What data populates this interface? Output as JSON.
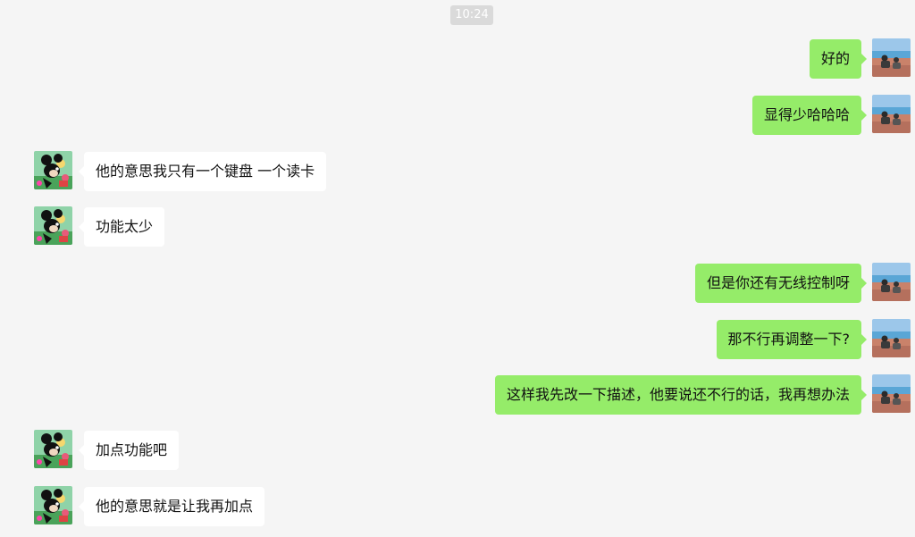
{
  "chat": {
    "timestamp": "10:24",
    "messages": [
      {
        "direction": "out",
        "text": "好的",
        "avatar": "beach-photo-avatar"
      },
      {
        "direction": "out",
        "text": "显得少哈哈哈",
        "avatar": "beach-photo-avatar"
      },
      {
        "direction": "in",
        "text": "他的意思我只有一个键盘 一个读卡",
        "avatar": "cartoon-mouse-avatar"
      },
      {
        "direction": "in",
        "text": "功能太少",
        "avatar": "cartoon-mouse-avatar"
      },
      {
        "direction": "out",
        "text": "但是你还有无线控制呀",
        "avatar": "beach-photo-avatar"
      },
      {
        "direction": "out",
        "text": "那不行再调整一下?",
        "avatar": "beach-photo-avatar"
      },
      {
        "direction": "out",
        "text": "这样我先改一下描述，他要说还不行的话，我再想办法",
        "avatar": "beach-photo-avatar"
      },
      {
        "direction": "in",
        "text": "加点功能吧",
        "avatar": "cartoon-mouse-avatar"
      },
      {
        "direction": "in",
        "text": "他的意思就是让我再加点",
        "avatar": "cartoon-mouse-avatar"
      }
    ]
  },
  "colors": {
    "background": "#f5f5f5",
    "outgoing_bubble": "#95ec69",
    "incoming_bubble": "#ffffff",
    "timestamp_bg": "#dadada"
  }
}
